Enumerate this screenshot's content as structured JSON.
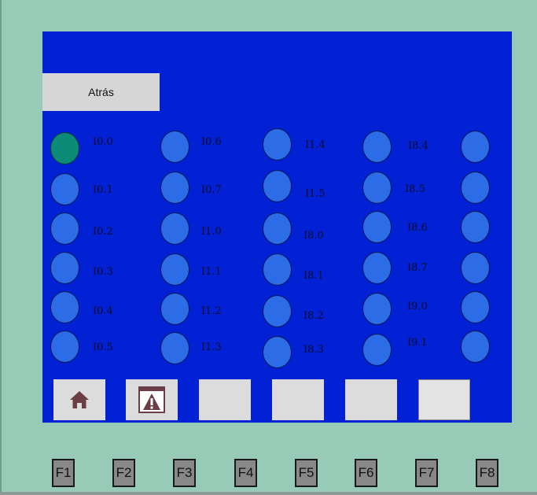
{
  "screen": {
    "back_button": "Atrás"
  },
  "io_columns": [
    [
      "I0.0",
      "I0.1",
      "I0.2",
      "I0.3",
      "I0.4",
      "I0.5"
    ],
    [
      "I0.6",
      "I0.7",
      "I1.0",
      "I1.1",
      "I1.2",
      "I1.3"
    ],
    [
      "I1.4",
      "I1.5",
      "I8.0",
      "I8.1",
      "I8.2",
      "I8.3"
    ],
    [
      "I8.4",
      "I8.5",
      "I8.6",
      "I8.7",
      "I9.0",
      "I9.1"
    ]
  ],
  "indicator_states": {
    "active": [
      "I0.0"
    ]
  },
  "softkeys": [
    {
      "icon": "home-icon"
    },
    {
      "icon": "warning-icon"
    },
    {
      "icon": ""
    },
    {
      "icon": ""
    },
    {
      "icon": ""
    },
    {
      "icon": ""
    }
  ],
  "function_keys": [
    "F1",
    "F2",
    "F3",
    "F4",
    "F5",
    "F6",
    "F7",
    "F8"
  ],
  "colors": {
    "screen": "#0221d4",
    "indicator_off": "#2c6ce6",
    "indicator_on": "#0c8b78",
    "panel_frame": "#97cab7",
    "button": "#d6d6d6"
  }
}
